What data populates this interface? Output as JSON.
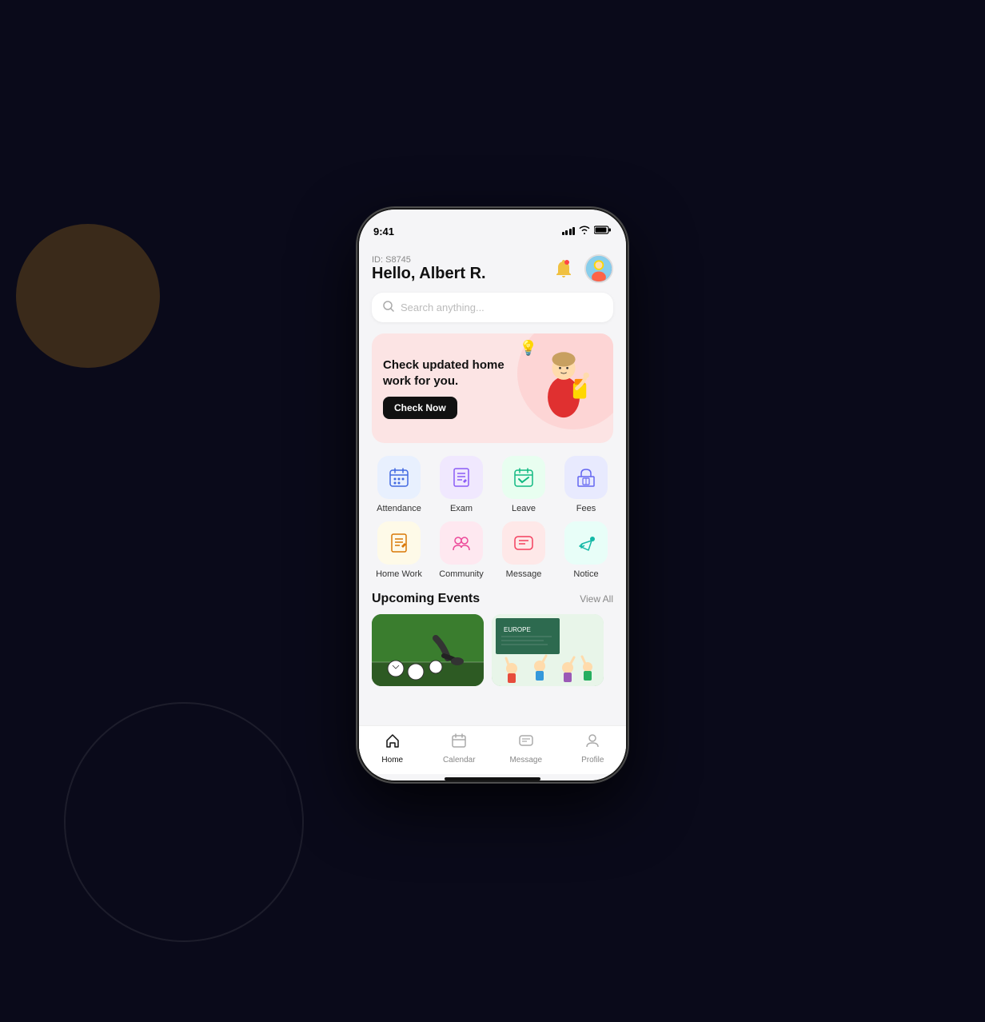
{
  "background": {
    "color": "#0a0a1a"
  },
  "phone": {
    "status_bar": {
      "time": "9:41",
      "signal": "signal",
      "wifi": "wifi",
      "battery": "battery"
    },
    "header": {
      "user_id": "ID: S8745",
      "greeting": "Hello, Albert R.",
      "bell_icon": "bell-icon",
      "avatar_icon": "avatar-icon"
    },
    "search": {
      "placeholder": "Search anything..."
    },
    "banner": {
      "title": "Check updated home work for you.",
      "button_label": "Check Now",
      "lightbulb_icon": "lightbulb-icon"
    },
    "icon_grid": {
      "row1": [
        {
          "id": "attendance",
          "label": "Attendance",
          "icon": "📅",
          "bg": "bg-blue-light"
        },
        {
          "id": "exam",
          "label": "Exam",
          "icon": "📋",
          "bg": "bg-purple-light"
        },
        {
          "id": "leave",
          "label": "Leave",
          "icon": "📊",
          "bg": "bg-green-light"
        },
        {
          "id": "fees",
          "label": "Fees",
          "icon": "🏛",
          "bg": "bg-indigo-light"
        }
      ],
      "row2": [
        {
          "id": "homework",
          "label": "Home Work",
          "icon": "📝",
          "bg": "bg-yellow-light"
        },
        {
          "id": "community",
          "label": "Community",
          "icon": "👥",
          "bg": "bg-pink-light"
        },
        {
          "id": "message",
          "label": "Message",
          "icon": "💬",
          "bg": "bg-rose-light"
        },
        {
          "id": "notice",
          "label": "Notice",
          "icon": "📢",
          "bg": "bg-teal-light"
        }
      ]
    },
    "events": {
      "section_title": "Upcoming Events",
      "view_all_label": "View All",
      "cards": [
        {
          "id": "football",
          "type": "football"
        },
        {
          "id": "classroom",
          "type": "classroom"
        }
      ]
    },
    "bottom_nav": {
      "items": [
        {
          "id": "home",
          "label": "Home",
          "icon": "🏠",
          "active": true
        },
        {
          "id": "calendar",
          "label": "Calendar",
          "icon": "📅",
          "active": false
        },
        {
          "id": "message",
          "label": "Message",
          "icon": "💬",
          "active": false
        },
        {
          "id": "profile",
          "label": "Profile",
          "icon": "👤",
          "active": false
        }
      ]
    }
  }
}
